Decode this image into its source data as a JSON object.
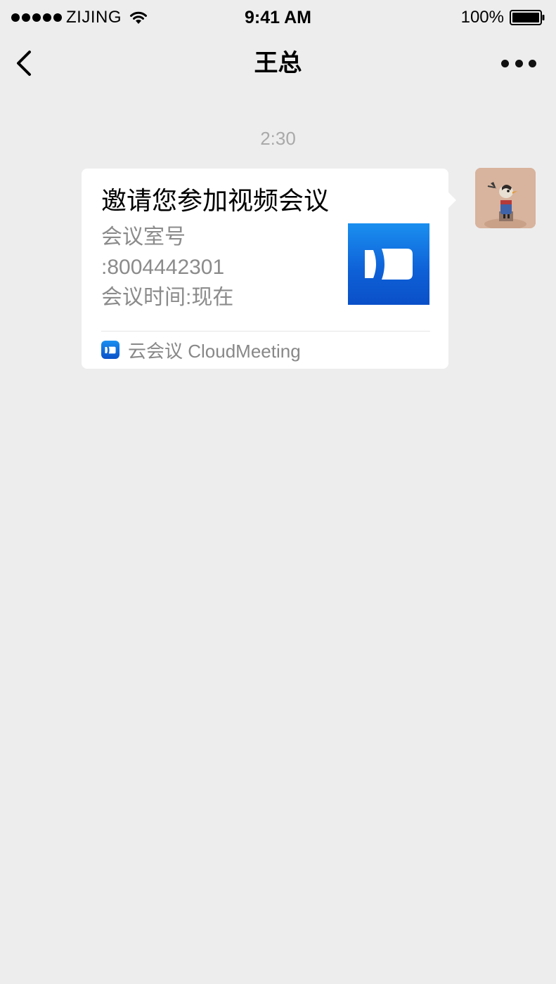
{
  "status_bar": {
    "carrier": "ZIJING",
    "time": "9:41 AM",
    "battery": "100%"
  },
  "nav": {
    "title": "王总"
  },
  "chat": {
    "timestamp": "2:30",
    "message": {
      "title": "邀请您参加视频会议",
      "lines": [
        "会议室号",
        ":8004442301",
        "会议时间:现在"
      ],
      "footer_label": "云会议 CloudMeeting",
      "accent_color": "#0e5fd6"
    }
  }
}
